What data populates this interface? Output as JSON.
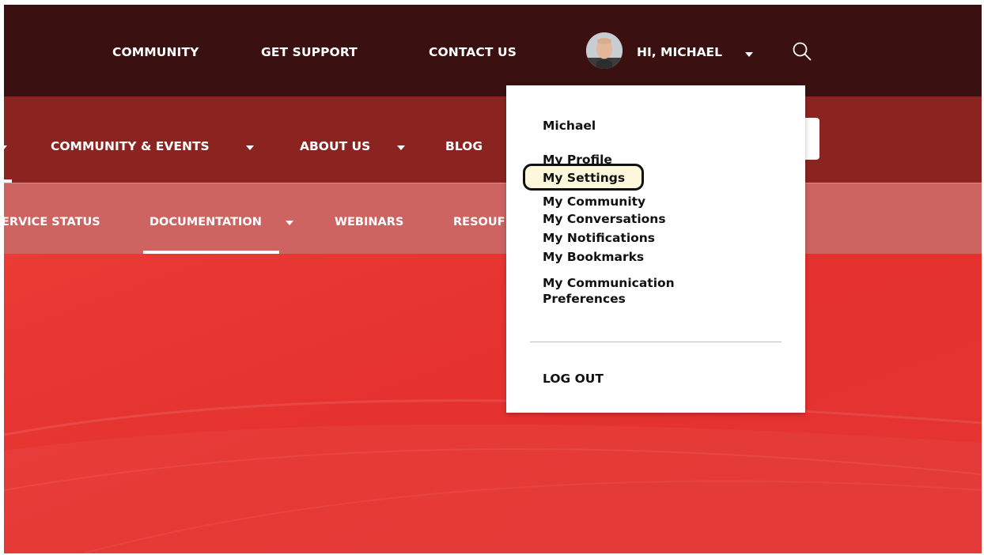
{
  "topbar": {
    "links": [
      "COMMUNITY",
      "GET SUPPORT",
      "CONTACT US"
    ],
    "greeting": "HI, MICHAEL"
  },
  "mainnav": {
    "items": [
      {
        "label": "COMMUNITY & EVENTS"
      },
      {
        "label": "ABOUT US"
      },
      {
        "label": "BLOG"
      }
    ]
  },
  "subnav": {
    "items": [
      {
        "label": "ERVICE STATUS"
      },
      {
        "label": "DOCUMENTATION"
      },
      {
        "label": "WEBINARS"
      },
      {
        "label": "RESOUF"
      }
    ]
  },
  "dropdown": {
    "user_name": "Michael",
    "items": [
      "My Profile",
      "My Settings",
      "My Community",
      "My Conversations",
      "My Notifications",
      "My Bookmarks",
      "My Communication Preferences"
    ],
    "logout": "LOG OUT"
  },
  "colors": {
    "topbar": "#3a1110",
    "mainnav": "#8b2420",
    "subnav": "#cd6462",
    "hero": "#e5322f",
    "highlight": "#fdf8dc"
  },
  "icons": {
    "search": "search-icon",
    "avatar": "avatar"
  }
}
